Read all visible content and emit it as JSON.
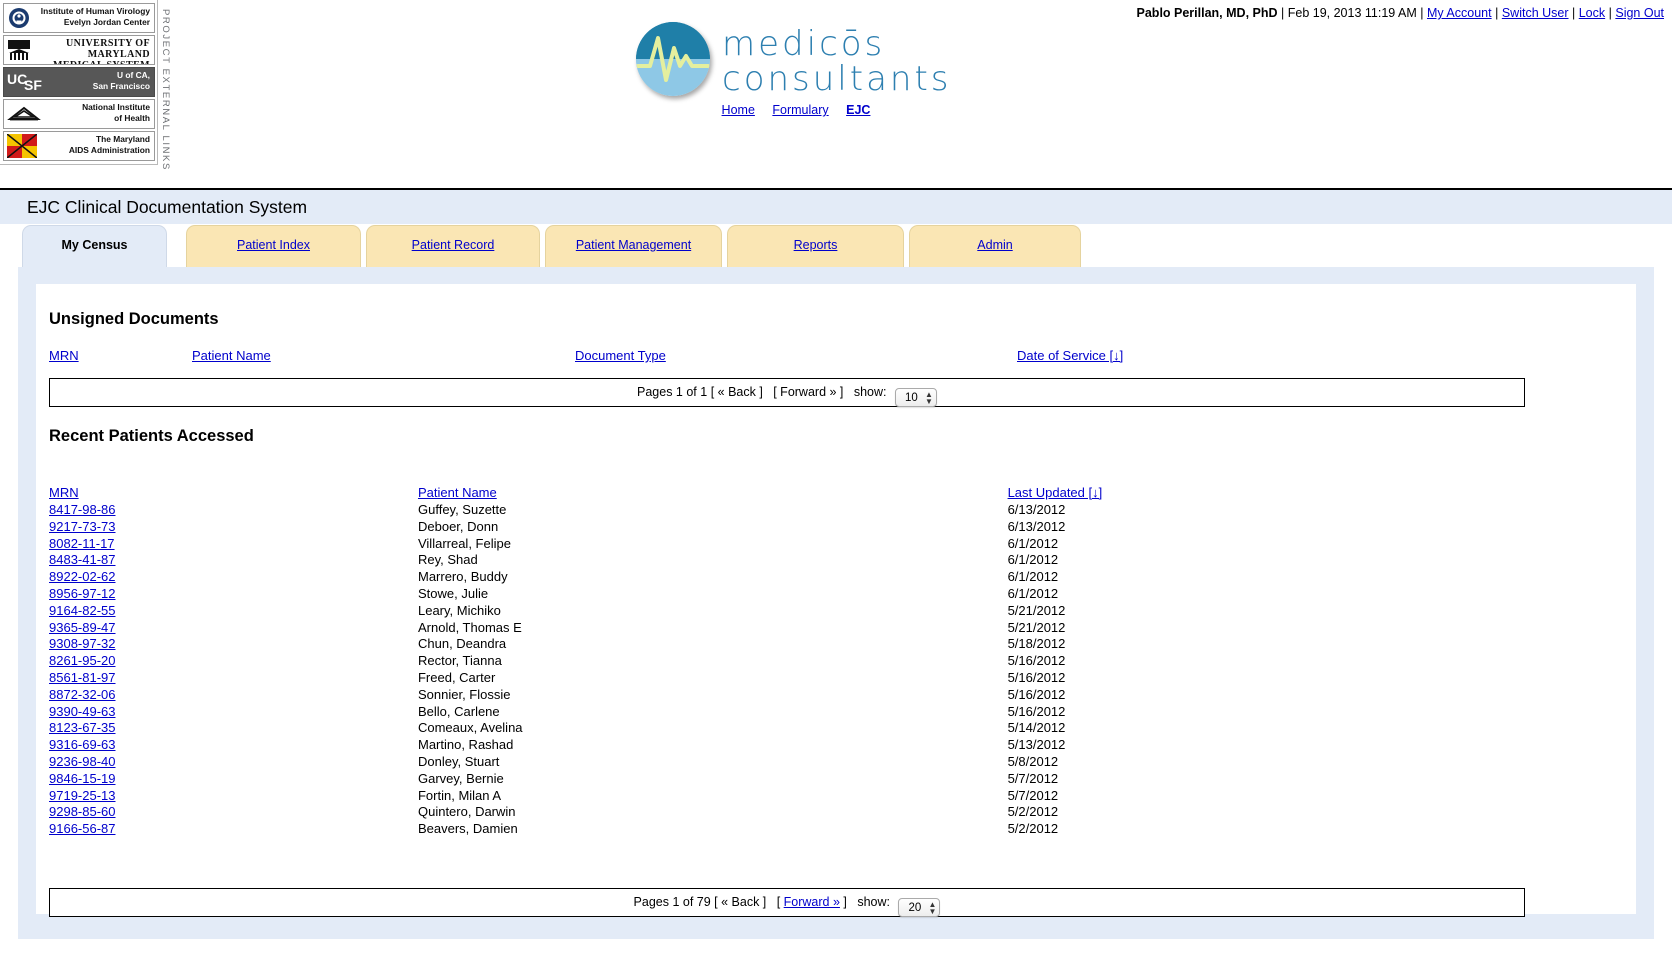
{
  "header": {
    "user_name": "Pablo Perillan, MD, PhD",
    "timestamp": "Feb 19, 2013 11:19 AM",
    "links": [
      {
        "label": "My Account"
      },
      {
        "label": "Switch User"
      },
      {
        "label": "Lock"
      },
      {
        "label": "Sign Out"
      }
    ],
    "separator": "|"
  },
  "external_links": {
    "vertical_label": "PROJECT EXTERNAL LINKS",
    "logos": [
      {
        "line1": "Institute of Human Virology",
        "line2": "Evelyn Jordan Center",
        "style": "light"
      },
      {
        "line1": "UNIVERSITY OF MARYLAND",
        "line2": "MEDICAL  SYSTEM",
        "style": "light"
      },
      {
        "line1": "U of CA,",
        "line2": "San Francisco",
        "style": "dark"
      },
      {
        "line1": "National Institute",
        "line2": "of Health",
        "style": "light"
      },
      {
        "line1": "The Maryland",
        "line2": "AIDS Administration",
        "style": "light"
      }
    ]
  },
  "brand": {
    "line1": "medicōs",
    "line2": "consultants",
    "color": "#2d7fb0",
    "nav": [
      {
        "label": "Home",
        "current": false
      },
      {
        "label": "Formulary",
        "current": false
      },
      {
        "label": "EJC",
        "current": true
      }
    ]
  },
  "app": {
    "title": "EJC Clinical Documentation System"
  },
  "tabs": [
    {
      "label": "My Census",
      "active": true
    },
    {
      "label": "Patient Index",
      "active": false
    },
    {
      "label": "Patient Record",
      "active": false
    },
    {
      "label": "Patient Management",
      "active": false
    },
    {
      "label": "Reports",
      "active": false
    },
    {
      "label": "Admin",
      "active": false
    }
  ],
  "unsigned_documents": {
    "heading": "Unsigned Documents",
    "columns": [
      "MRN",
      "Patient Name",
      "Document Type",
      "Date of Service [↓]"
    ],
    "rows": [],
    "pagination": {
      "pages_text": "Pages 1 of 1",
      "back": "[ « Back ]",
      "forward": "[ Forward » ]",
      "forward_link": false,
      "show_label": "show:",
      "show_value": "10"
    }
  },
  "recent_patients": {
    "heading": "Recent Patients Accessed",
    "columns": [
      "MRN",
      "Patient Name",
      "Last Updated [↓]"
    ],
    "rows": [
      {
        "mrn": "8417-98-86",
        "name": "Guffey, Suzette",
        "updated": "6/13/2012"
      },
      {
        "mrn": "9217-73-73",
        "name": "Deboer, Donn",
        "updated": "6/13/2012"
      },
      {
        "mrn": "8082-11-17",
        "name": "Villarreal, Felipe",
        "updated": "6/1/2012"
      },
      {
        "mrn": "8483-41-87",
        "name": "Rey, Shad",
        "updated": "6/1/2012"
      },
      {
        "mrn": "8922-02-62",
        "name": "Marrero, Buddy",
        "updated": "6/1/2012"
      },
      {
        "mrn": "8956-97-12",
        "name": "Stowe, Julie",
        "updated": "6/1/2012"
      },
      {
        "mrn": "9164-82-55",
        "name": "Leary, Michiko",
        "updated": "5/21/2012"
      },
      {
        "mrn": "9365-89-47",
        "name": "Arnold, Thomas E",
        "updated": "5/21/2012"
      },
      {
        "mrn": "9308-97-32",
        "name": "Chun, Deandra",
        "updated": "5/18/2012"
      },
      {
        "mrn": "8261-95-20",
        "name": "Rector, Tianna",
        "updated": "5/16/2012"
      },
      {
        "mrn": "8561-81-97",
        "name": "Freed, Carter",
        "updated": "5/16/2012"
      },
      {
        "mrn": "8872-32-06",
        "name": "Sonnier, Flossie",
        "updated": "5/16/2012"
      },
      {
        "mrn": "9390-49-63",
        "name": "Bello, Carlene",
        "updated": "5/16/2012"
      },
      {
        "mrn": "8123-67-35",
        "name": "Comeaux, Avelina",
        "updated": "5/14/2012"
      },
      {
        "mrn": "9316-69-63",
        "name": "Martino, Rashad",
        "updated": "5/13/2012"
      },
      {
        "mrn": "9236-98-40",
        "name": "Donley, Stuart",
        "updated": "5/8/2012"
      },
      {
        "mrn": "9846-15-19",
        "name": "Garvey, Bernie",
        "updated": "5/7/2012"
      },
      {
        "mrn": "9719-25-13",
        "name": "Fortin, Milan A",
        "updated": "5/7/2012"
      },
      {
        "mrn": "9298-85-60",
        "name": "Quintero, Darwin",
        "updated": "5/2/2012"
      },
      {
        "mrn": "9166-56-87",
        "name": "Beavers, Damien",
        "updated": "5/2/2012"
      }
    ],
    "pagination": {
      "pages_text": "Pages 1 of 79",
      "back": "[ « Back ]",
      "forward": "Forward »",
      "forward_link": true,
      "show_label": "show:",
      "show_value": "20"
    }
  }
}
